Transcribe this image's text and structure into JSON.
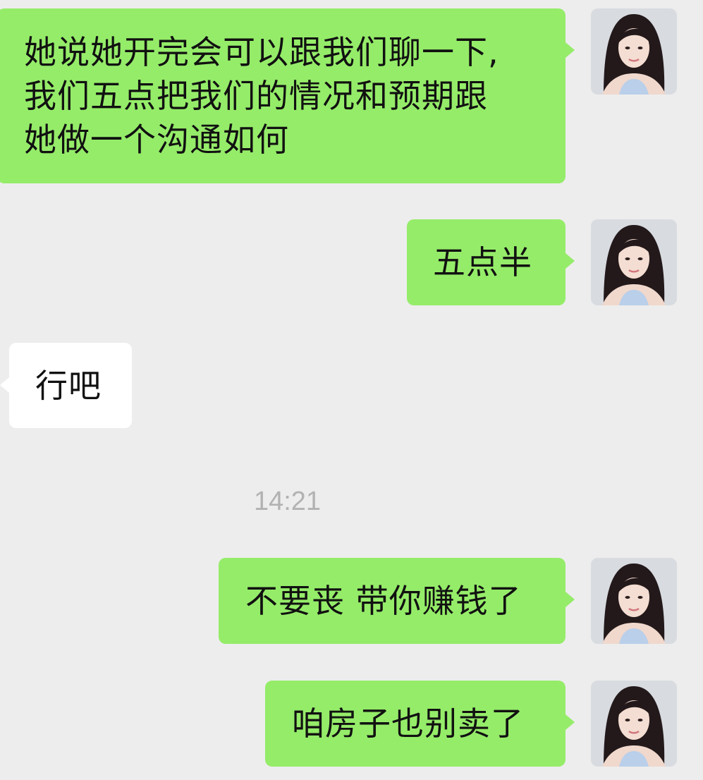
{
  "chat": {
    "messages": [
      {
        "sender": "me",
        "lines": [
          "她说她开完会可以跟我们聊一下,",
          "我们五点把我们的情况和预期跟",
          "她做一个沟通如何"
        ]
      },
      {
        "sender": "me",
        "text": "五点半"
      },
      {
        "sender": "other",
        "text": "行吧"
      },
      {
        "sender": "me",
        "text": "不要丧 带你赚钱了"
      },
      {
        "sender": "me",
        "text": "咱房子也别卖了"
      }
    ],
    "timestamp": "14:21"
  },
  "colors": {
    "background": "#ededed",
    "my_bubble": "#95ec69",
    "other_bubble": "#ffffff",
    "timestamp_text": "#b2b2b2"
  },
  "icons": {
    "avatar": "user-avatar-photo"
  }
}
